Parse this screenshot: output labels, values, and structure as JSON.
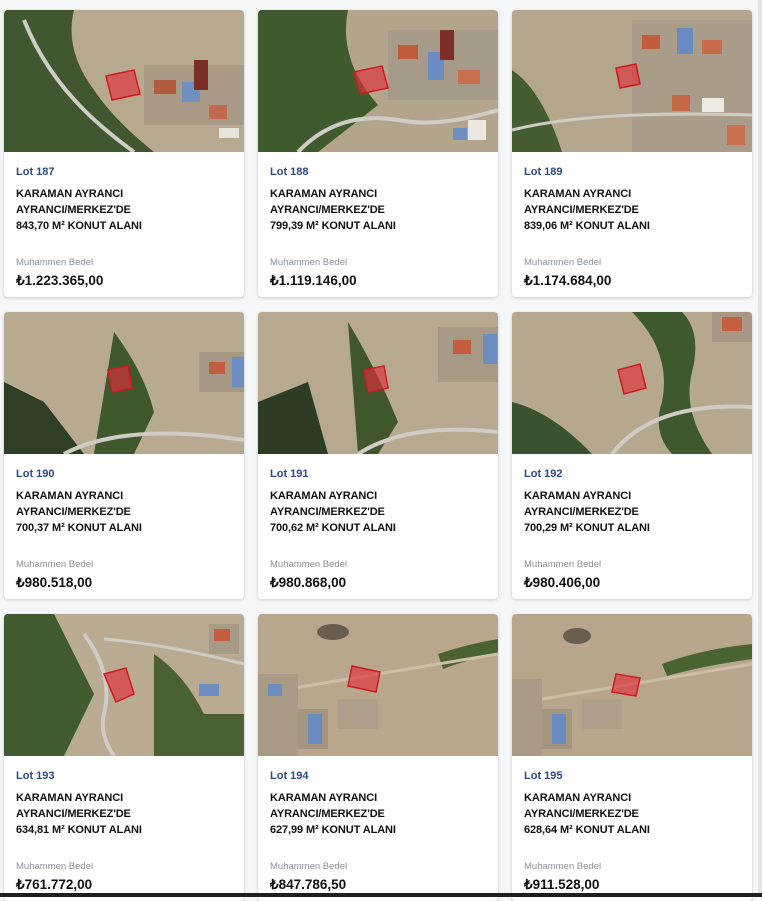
{
  "lots": [
    {
      "lot": "Lot 187",
      "title_line1": "KARAMAN AYRANCI AYRANCI/MERKEZ'DE",
      "title_line2": "843,70 M² KONUT ALANI",
      "price_label": "Muhammen Bedel",
      "price": "₺1.223.365,00",
      "image_alt": "satellite-parcel-map"
    },
    {
      "lot": "Lot 188",
      "title_line1": "KARAMAN AYRANCI AYRANCI/MERKEZ'DE",
      "title_line2": "799,39 M² KONUT ALANI",
      "price_label": "Muhammen Bedel",
      "price": "₺1.119.146,00",
      "image_alt": "satellite-parcel-map"
    },
    {
      "lot": "Lot 189",
      "title_line1": "KARAMAN AYRANCI AYRANCI/MERKEZ'DE",
      "title_line2": "839,06 M² KONUT ALANI",
      "price_label": "Muhammen Bedel",
      "price": "₺1.174.684,00",
      "image_alt": "satellite-parcel-map"
    },
    {
      "lot": "Lot 190",
      "title_line1": "KARAMAN AYRANCI AYRANCI/MERKEZ'DE",
      "title_line2": "700,37 M² KONUT ALANI",
      "price_label": "Muhammen Bedel",
      "price": "₺980.518,00",
      "image_alt": "satellite-parcel-map"
    },
    {
      "lot": "Lot 191",
      "title_line1": "KARAMAN AYRANCI AYRANCI/MERKEZ'DE",
      "title_line2": "700,62 M² KONUT ALANI",
      "price_label": "Muhammen Bedel",
      "price": "₺980.868,00",
      "image_alt": "satellite-parcel-map"
    },
    {
      "lot": "Lot 192",
      "title_line1": "KARAMAN AYRANCI AYRANCI/MERKEZ'DE",
      "title_line2": "700,29 M² KONUT ALANI",
      "price_label": "Muhammen Bedel",
      "price": "₺980.406,00",
      "image_alt": "satellite-parcel-map"
    },
    {
      "lot": "Lot 193",
      "title_line1": "KARAMAN AYRANCI AYRANCI/MERKEZ'DE",
      "title_line2": "634,81 M² KONUT ALANI",
      "price_label": "Muhammen Bedel",
      "price": "₺761.772,00",
      "image_alt": "satellite-parcel-map"
    },
    {
      "lot": "Lot 194",
      "title_line1": "KARAMAN AYRANCI AYRANCI/MERKEZ'DE",
      "title_line2": "627,99 M² KONUT ALANI",
      "price_label": "Muhammen Bedel",
      "price": "₺847.786,50",
      "image_alt": "satellite-parcel-map"
    },
    {
      "lot": "Lot 195",
      "title_line1": "KARAMAN AYRANCI AYRANCI/MERKEZ'DE",
      "title_line2": "628,64 M² KONUT ALANI",
      "price_label": "Muhammen Bedel",
      "price": "₺911.528,00",
      "image_alt": "satellite-parcel-map"
    }
  ],
  "colors": {
    "lot_accent": "#2c4a86",
    "parcel_fill": "#e0303a",
    "terrain": "#b9a98e",
    "vegetation": "#3d5a2e",
    "road": "#c9c9c6"
  }
}
